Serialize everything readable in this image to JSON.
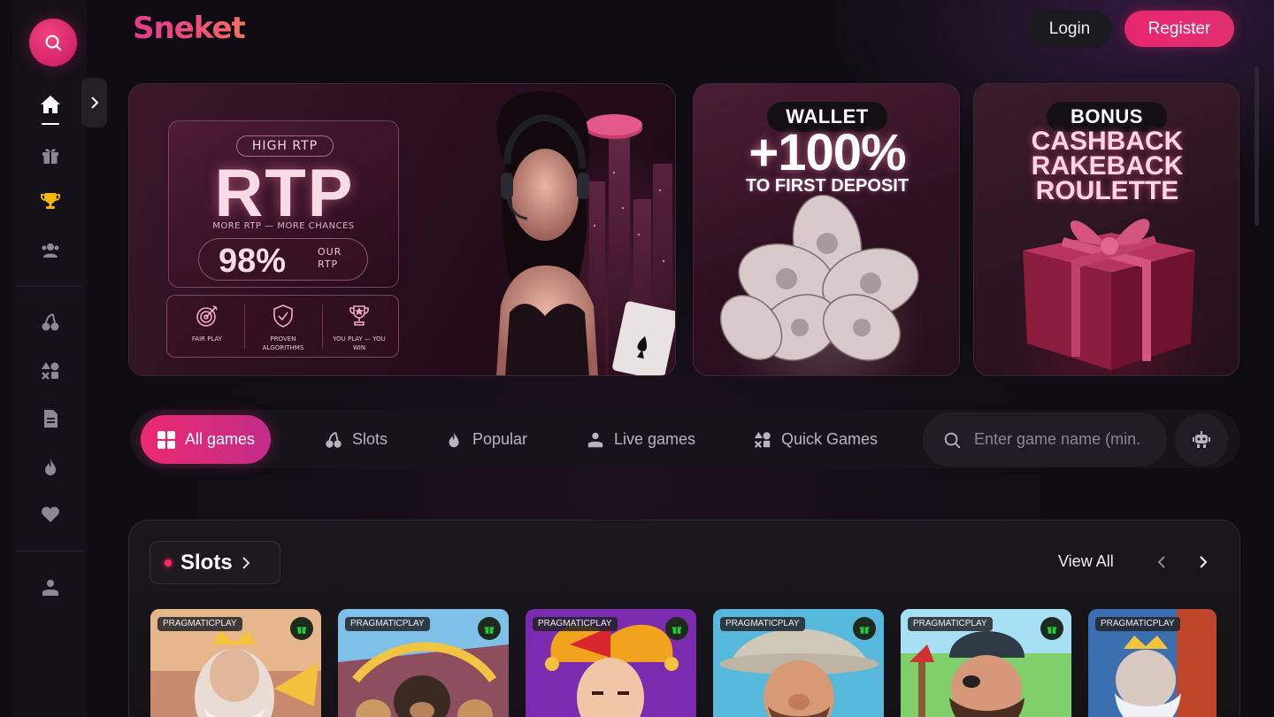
{
  "brand": {
    "logo_text": "Sneket"
  },
  "header": {
    "login_label": "Login",
    "register_label": "Register"
  },
  "sidebar": {
    "items": [
      {
        "icon": "home-icon"
      },
      {
        "icon": "gift-icon"
      },
      {
        "icon": "trophy-icon"
      },
      {
        "icon": "users-icon"
      },
      {
        "icon": "slots-cherry-icon"
      },
      {
        "icon": "quick-games-icon"
      },
      {
        "icon": "document-icon"
      },
      {
        "icon": "flame-icon"
      },
      {
        "icon": "heart-icon"
      },
      {
        "icon": "live-dealer-icon"
      }
    ],
    "active_color": "#ffffff",
    "trophy_color": "#f5b800"
  },
  "banners": {
    "rtp": {
      "tag": "HIGH RTP",
      "headline": "RTP",
      "subline": "MORE RTP — MORE CHANCES",
      "percent": "98%",
      "percent_label": "OUR RTP",
      "features": [
        {
          "label": "FAIR PLAY"
        },
        {
          "label": "PROVEN ALGORITHMS"
        },
        {
          "label": "YOU PLAY — YOU WIN"
        }
      ]
    },
    "wallet": {
      "tag": "WALLET",
      "headline": "+100%",
      "subline": "TO FIRST DEPOSIT"
    },
    "bonus": {
      "tag": "BONUS",
      "lines": [
        "CASHBACK",
        "RAKEBACK",
        "ROULETTE"
      ]
    }
  },
  "filters": {
    "tabs": [
      {
        "label": "All games",
        "active": true
      },
      {
        "label": "Slots",
        "active": false
      },
      {
        "label": "Popular",
        "active": false
      },
      {
        "label": "Live games",
        "active": false
      },
      {
        "label": "Quick Games",
        "active": false
      }
    ],
    "search_placeholder": "Enter game name (min."
  },
  "slots_section": {
    "title": "Slots",
    "view_all_label": "View All",
    "games": [
      {
        "provider": "PRAGMATICPLAY"
      },
      {
        "provider": "PRAGMATICPLAY"
      },
      {
        "provider": "PRAGMATICPLAY"
      },
      {
        "provider": "PRAGMATICPLAY"
      },
      {
        "provider": "PRAGMATICPLAY"
      },
      {
        "provider": "PRAGMATICPLAY"
      }
    ]
  },
  "colors": {
    "accent": "#e8266d",
    "background": "#0f0d13",
    "gift_badge": "#27c93f"
  }
}
